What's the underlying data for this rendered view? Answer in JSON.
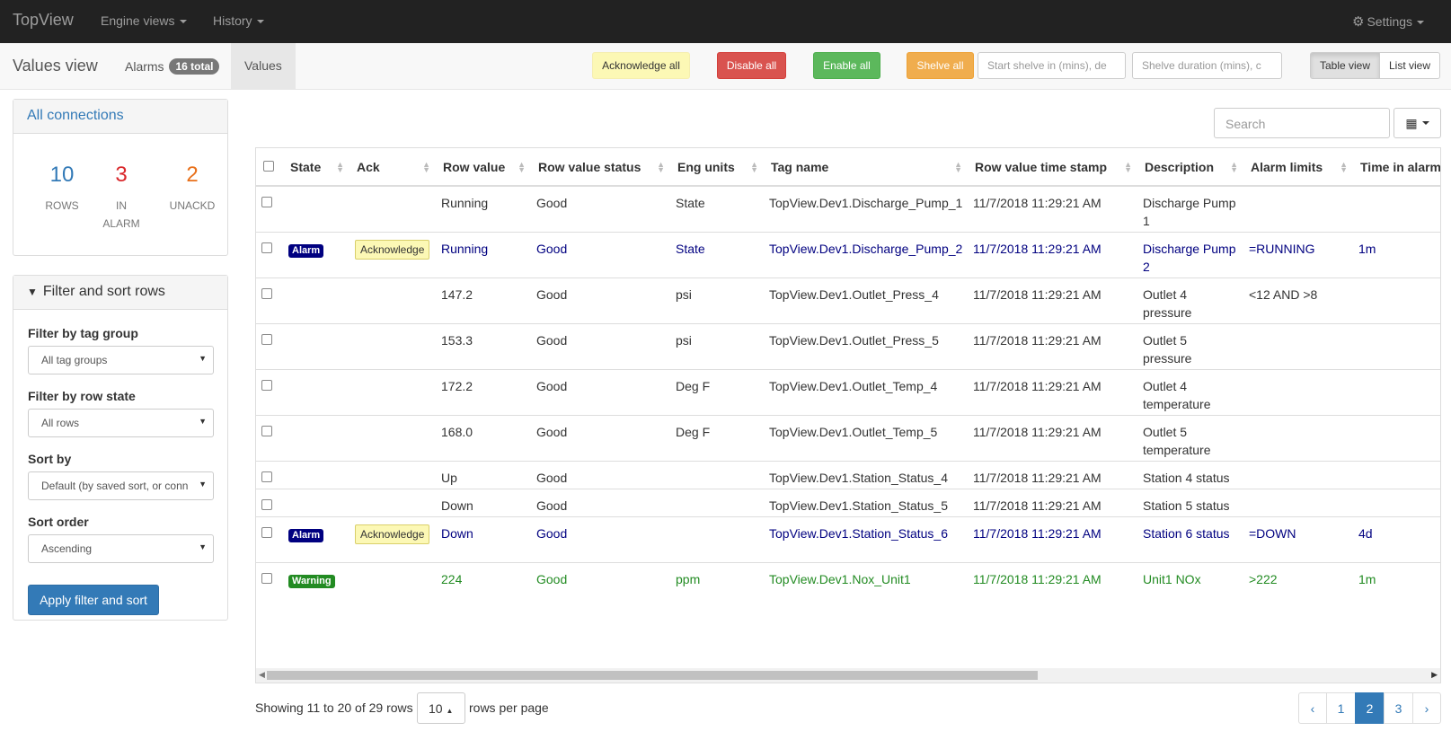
{
  "nav": {
    "brand": "TopView",
    "engine_views": "Engine views",
    "history": "History",
    "settings": "Settings"
  },
  "subnav": {
    "title": "Values view",
    "alarms_label": "Alarms",
    "alarms_badge": "16 total",
    "values_label": "Values"
  },
  "toolbar": {
    "acknowledge_all": "Acknowledge all",
    "disable_all": "Disable all",
    "enable_all": "Enable all",
    "shelve_all": "Shelve all",
    "start_shelve_placeholder": "Start shelve in (mins), de",
    "shelve_duration_placeholder": "Shelve duration (mins), c",
    "table_view": "Table view",
    "list_view": "List view"
  },
  "connections": {
    "title": "All connections",
    "rows_value": "10",
    "rows_label": "ROWS",
    "alarm_value": "3",
    "alarm_label_1": "IN",
    "alarm_label_2": "ALARM",
    "unackd_value": "2",
    "unackd_label": "UNACKD"
  },
  "filter": {
    "title": "Filter and sort rows",
    "tag_group_label": "Filter by tag group",
    "tag_group_value": "All tag groups",
    "row_state_label": "Filter by row state",
    "row_state_value": "All rows",
    "sort_by_label": "Sort by",
    "sort_by_value": "Default (by saved sort, or conn",
    "sort_order_label": "Sort order",
    "sort_order_value": "Ascending",
    "apply_label": "Apply filter and sort"
  },
  "search_placeholder": "Search",
  "table": {
    "headers": [
      "State",
      "Ack",
      "Row value",
      "Row value status",
      "Eng units",
      "Tag name",
      "Row value time stamp",
      "Description",
      "Alarm limits",
      "Time in alarm"
    ],
    "rows": [
      {
        "state": "",
        "ack": "",
        "value": "Running",
        "status": "Good",
        "units": "State",
        "tag": "TopView.Dev1.Discharge_Pump_1",
        "ts": "11/7/2018 11:29:21 AM",
        "desc": "Discharge Pump 1",
        "limits": "",
        "time": ""
      },
      {
        "state": "Alarm",
        "ack": "Acknowledge",
        "value": "Running",
        "status": "Good",
        "units": "State",
        "tag": "TopView.Dev1.Discharge_Pump_2",
        "ts": "11/7/2018 11:29:21 AM",
        "desc": "Discharge Pump 2",
        "limits": "=RUNNING",
        "time": "1m"
      },
      {
        "state": "",
        "ack": "",
        "value": "147.2",
        "status": "Good",
        "units": "psi",
        "tag": "TopView.Dev1.Outlet_Press_4",
        "ts": "11/7/2018 11:29:21 AM",
        "desc": "Outlet 4 pressure",
        "limits": "<12 AND >8",
        "time": ""
      },
      {
        "state": "",
        "ack": "",
        "value": "153.3",
        "status": "Good",
        "units": "psi",
        "tag": "TopView.Dev1.Outlet_Press_5",
        "ts": "11/7/2018 11:29:21 AM",
        "desc": "Outlet 5 pressure",
        "limits": "",
        "time": ""
      },
      {
        "state": "",
        "ack": "",
        "value": "172.2",
        "status": "Good",
        "units": "Deg F",
        "tag": "TopView.Dev1.Outlet_Temp_4",
        "ts": "11/7/2018 11:29:21 AM",
        "desc": "Outlet 4 temperature",
        "limits": "",
        "time": ""
      },
      {
        "state": "",
        "ack": "",
        "value": "168.0",
        "status": "Good",
        "units": "Deg F",
        "tag": "TopView.Dev1.Outlet_Temp_5",
        "ts": "11/7/2018 11:29:21 AM",
        "desc": "Outlet 5 temperature",
        "limits": "",
        "time": ""
      },
      {
        "state": "",
        "ack": "",
        "value": "Up",
        "status": "Good",
        "units": "",
        "tag": "TopView.Dev1.Station_Status_4",
        "ts": "11/7/2018 11:29:21 AM",
        "desc": "Station 4 status",
        "limits": "",
        "time": ""
      },
      {
        "state": "",
        "ack": "",
        "value": "Down",
        "status": "Good",
        "units": "",
        "tag": "TopView.Dev1.Station_Status_5",
        "ts": "11/7/2018 11:29:21 AM",
        "desc": "Station 5 status",
        "limits": "",
        "time": ""
      },
      {
        "state": "Alarm",
        "ack": "Acknowledge",
        "value": "Down",
        "status": "Good",
        "units": "",
        "tag": "TopView.Dev1.Station_Status_6",
        "ts": "11/7/2018 11:29:21 AM",
        "desc": "Station 6 status",
        "limits": "=DOWN",
        "time": "4d"
      },
      {
        "state": "Warning",
        "ack": "",
        "value": "224",
        "status": "Good",
        "units": "ppm",
        "tag": "TopView.Dev1.Nox_Unit1",
        "ts": "11/7/2018 11:29:21 AM",
        "desc": "Unit1 NOx",
        "limits": ">222",
        "time": "1m"
      }
    ]
  },
  "pagination": {
    "showing": "Showing 11 to 20 of 29 rows",
    "per_page_value": "10",
    "per_page_suffix": "rows per page",
    "prev": "‹",
    "pages": [
      "1",
      "2",
      "3"
    ],
    "active_page": "2",
    "next": "›"
  },
  "colors": {
    "alarm": "#000080",
    "warning": "#228b22",
    "rows_count": "#337ab7",
    "in_alarm_count": "#d9262a",
    "unackd_count": "#e8701a"
  }
}
